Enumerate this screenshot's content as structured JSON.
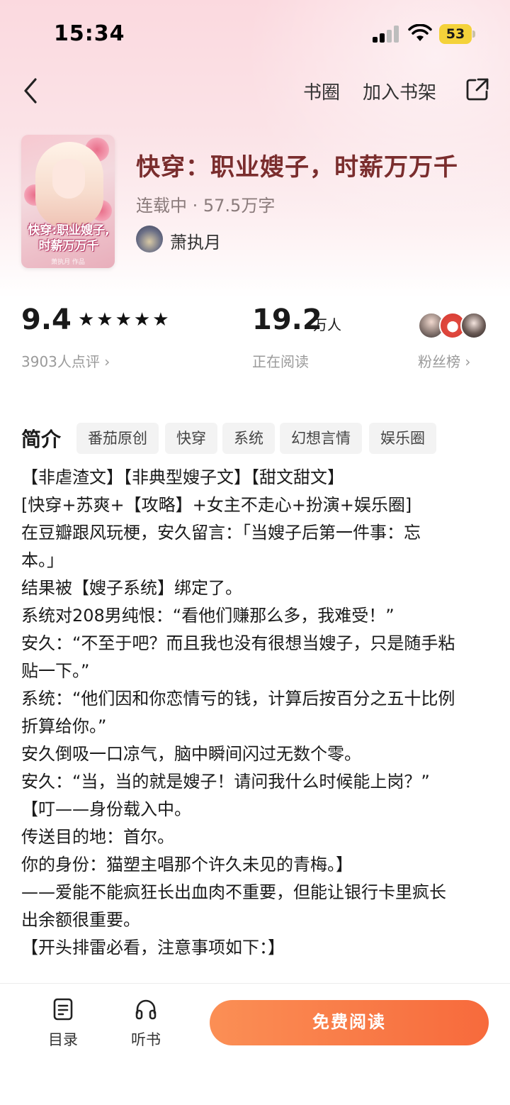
{
  "status_bar": {
    "time": "15:34",
    "battery": "53"
  },
  "nav": {
    "circle_label": "书圈",
    "add_shelf_label": "加入书架"
  },
  "book": {
    "cover_title": "快穿:职业嫂子,时薪万万千",
    "cover_subtitle": "萧执月 作品",
    "title": "快穿：职业嫂子，时薪万万千",
    "meta": "连载中 · 57.5万字",
    "author": "萧执月"
  },
  "stats": {
    "score": "9.4",
    "stars": "★★★★★",
    "reviews": "3903人点评 ›",
    "readers": "19.2",
    "readers_unit": "万人",
    "readers_label": "正在阅读",
    "fans_label": "粉丝榜 ›"
  },
  "intro": {
    "label": "简介",
    "tags": [
      "番茄原创",
      "快穿",
      "系统",
      "幻想言情",
      "娱乐圈"
    ],
    "lines": [
      "【非虐渣文】【非典型嫂子文】【甜文甜文】",
      "[快穿+苏爽+【攻略】+女主不走心+扮演+娱乐圈]",
      "在豆瓣跟风玩梗，安久留言：「当嫂子后第一件事：忘",
      "本。」",
      "结果被【嫂子系统】绑定了。",
      "系统对208男纯恨：“看他们赚那么多，我难受！”",
      "安久：“不至于吧？而且我也没有很想当嫂子，只是随手粘",
      "贴一下。”",
      "系统：“他们因和你恋情亏的钱，计算后按百分之五十比例",
      "折算给你。”",
      "安久倒吸一口凉气，脑中瞬间闪过无数个零。",
      "安久：“当，当的就是嫂子！请问我什么时候能上岗？”",
      "【叮——身份载入中。",
      "传送目的地：首尔。",
      "你的身份：猫塑主唱那个许久未见的青梅。】",
      "——爱能不能疯狂长出血肉不重要，但能让银行卡里疯长",
      "出余额很重要。",
      "【开头排雷必看，注意事项如下：】"
    ]
  },
  "bottom": {
    "catalog_label": "目录",
    "listen_label": "听书",
    "read_label": "免费阅读"
  }
}
